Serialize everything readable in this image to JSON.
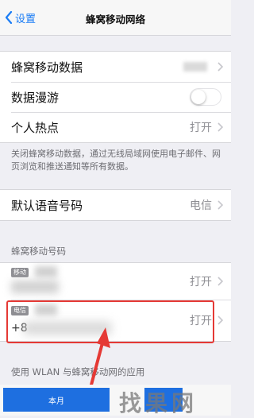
{
  "navbar": {
    "back_label": "设置",
    "title": "蜂窝移动网络"
  },
  "group1": {
    "cellular_data": "蜂窝移动数据",
    "roaming": "数据漫游",
    "hotspot": "个人热点",
    "hotspot_value": "打开"
  },
  "footnote": "关闭蜂窝移动数据，通过无线局域网使用电子邮件、网页浏览和推送通知等所有数据。",
  "default_voice": {
    "label": "默认语音号码",
    "value": "电信"
  },
  "cellular_numbers": {
    "header": "蜂窝移动号码",
    "lines": [
      {
        "badge": "移动",
        "value": "打开"
      },
      {
        "badge": "电信",
        "number_prefix": "+8",
        "value": "打开"
      }
    ]
  },
  "apps_section_header": "使用 WLAN 与蜂窝移动网的应用",
  "tabbar": {
    "left_label": "本月"
  },
  "watermark": "找果网",
  "colors": {
    "accent": "#1a7cf5",
    "highlight": "#e53935",
    "tab_blue": "#1e6fe0"
  }
}
